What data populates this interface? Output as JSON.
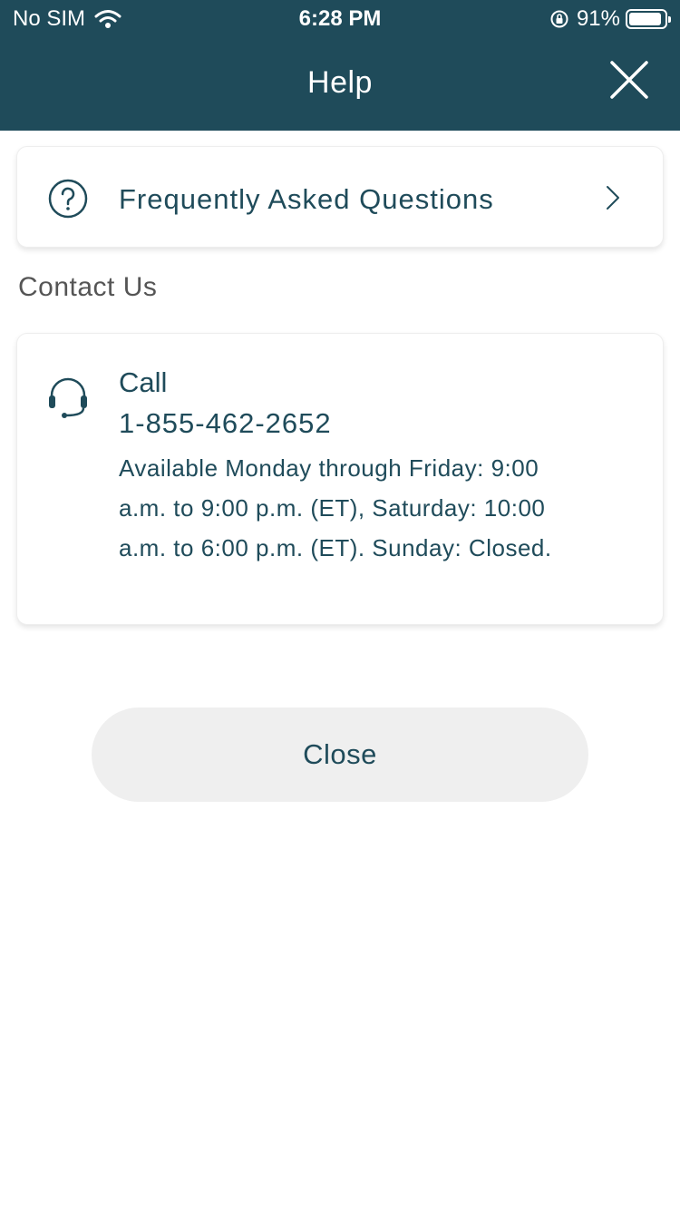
{
  "status_bar": {
    "carrier": "No SIM",
    "time": "6:28 PM",
    "battery_percent": "91%",
    "battery_level": 0.91,
    "icons": [
      "wifi-icon",
      "orientation-lock-icon",
      "battery-icon"
    ]
  },
  "nav": {
    "title": "Help",
    "close_icon": "close-icon"
  },
  "faq": {
    "label": "Frequently Asked Questions",
    "icon": "question-circle-icon",
    "chevron": "chevron-right-icon"
  },
  "contact": {
    "section_title": "Contact Us",
    "icon": "headset-icon",
    "call_label": "Call",
    "phone": "1-855-462-2652",
    "hours": "Available Monday through Friday: 9:00 a.m. to 9:00 p.m. (ET), Saturday: 10:00 a.m. to 6:00 p.m. (ET). Sunday: Closed."
  },
  "footer": {
    "close_label": "Close"
  },
  "colors": {
    "primary": "#1f4b5a",
    "background": "#ffffff",
    "button_bg": "#efefef",
    "section_text": "#555555"
  }
}
